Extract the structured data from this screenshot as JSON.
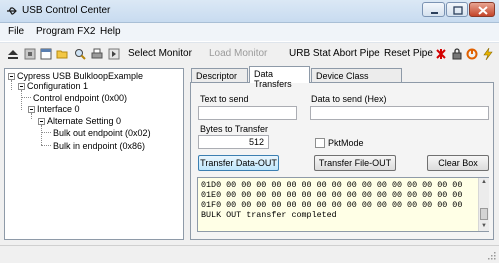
{
  "window": {
    "title": "USB Control Center"
  },
  "menu": {
    "items": [
      "File",
      "Program FX2",
      "Help"
    ]
  },
  "toolbar": {
    "icons": [
      "eject-icon",
      "stop-icon",
      "window-icon",
      "open-folder-icon",
      "search-icon",
      "print-icon",
      "arrow-icon"
    ],
    "select_monitor": "Select Monitor",
    "load_monitor": "Load Monitor",
    "urb_stat": "URB Stat",
    "abort_pipe": "Abort Pipe",
    "reset_pipe": "Reset Pipe",
    "accent_colors": {
      "reset_icon": "#d40000",
      "lock_icon": "#555555",
      "power_icon": "#e06000",
      "lightning_icon": "#e8b400"
    }
  },
  "tree": {
    "root": "Cypress USB BulkloopExample",
    "configuration": "Configuration 1",
    "control_endpoint": "Control endpoint (0x00)",
    "interface": "Interface 0",
    "alt_setting": "Alternate Setting 0",
    "bulk_out": "Bulk out endpoint (0x02)",
    "bulk_in": "Bulk in endpoint (0x86)"
  },
  "tabs": {
    "items": [
      "Descriptor Info",
      "Data Transfers",
      "Device Class Selection"
    ],
    "active": "Data Transfers"
  },
  "data_transfers": {
    "text_to_send_label": "Text to send",
    "text_to_send_value": "",
    "data_to_send_label": "Data to send (Hex)",
    "data_to_send_value": "",
    "bytes_to_transfer_label": "Bytes to Transfer",
    "bytes_to_transfer_value": "512",
    "pktmode_label": "PktMode",
    "pktmode_checked": false,
    "transfer_data_out": "Transfer Data-OUT",
    "transfer_file_out": "Transfer File-OUT",
    "clear_box": "Clear Box",
    "output_lines": [
      "01D0 00 00 00 00 00 00 00 00 00 00 00 00 00 00 00 00",
      "01E0 00 00 00 00 00 00 00 00 00 00 00 00 00 00 00 00",
      "01F0 00 00 00 00 00 00 00 00 00 00 00 00 00 00 00 00",
      "BULK OUT transfer completed"
    ]
  }
}
